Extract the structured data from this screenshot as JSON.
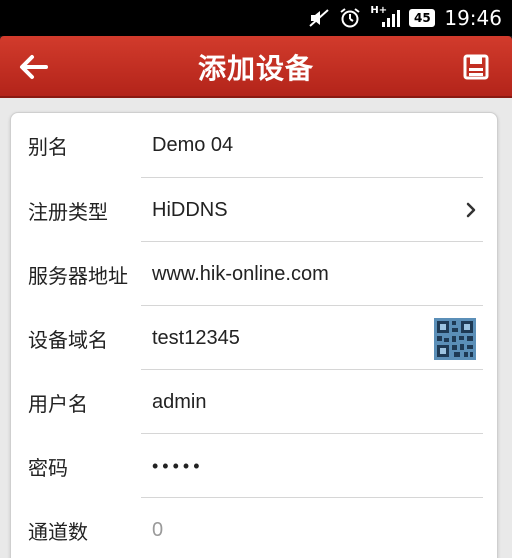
{
  "status_bar": {
    "network": "H+",
    "battery": "45",
    "time": "19:46",
    "icons": [
      "mute-icon",
      "alarm-icon",
      "signal-icon",
      "battery-icon"
    ]
  },
  "title_bar": {
    "title": "添加设备",
    "back_icon": "back-arrow-icon",
    "save_icon": "save-icon",
    "color": "#c0301f"
  },
  "form": {
    "rows": [
      {
        "label": "别名",
        "value": "Demo 04"
      },
      {
        "label": "注册类型",
        "value": "HiDDNS",
        "icon": "chevron-right-icon"
      },
      {
        "label": "服务器地址",
        "value": "www.hik-online.com"
      },
      {
        "label": "设备域名",
        "value": "test12345",
        "icon": "qr-code-icon"
      },
      {
        "label": "用户名",
        "value": "admin"
      },
      {
        "label": "密码",
        "value": "•••••"
      },
      {
        "label": "通道数",
        "value": "0"
      }
    ]
  }
}
